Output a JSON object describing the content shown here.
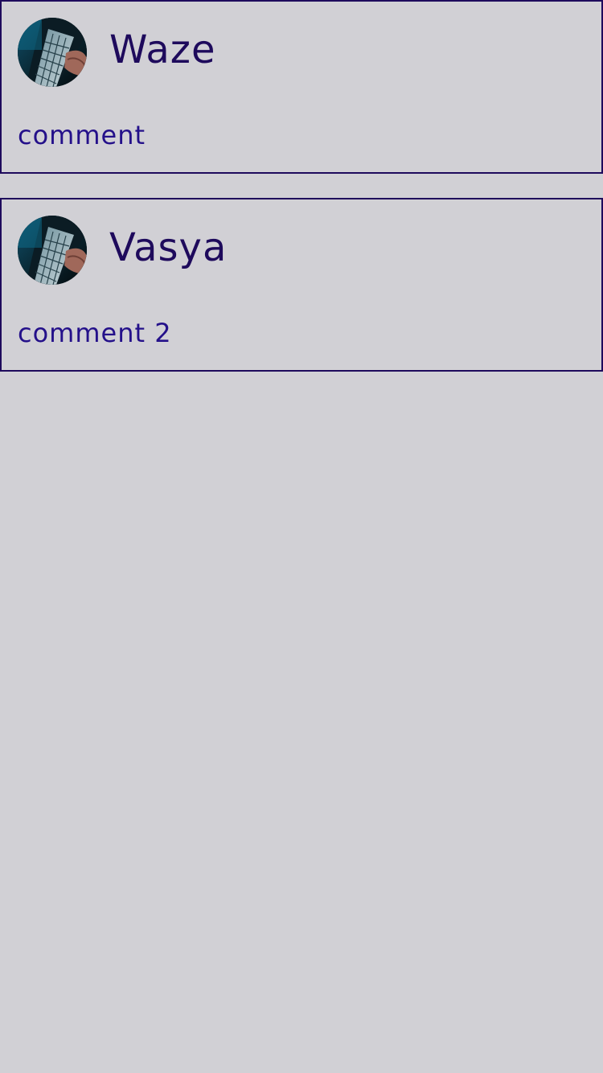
{
  "colors": {
    "background": "#d1d0d5",
    "border": "#1e0a5c",
    "author_text": "#1e0a5c",
    "comment_text": "#24108a"
  },
  "comments": [
    {
      "author": "Waze",
      "text": "comment",
      "avatar_icon": "laptop-keyboard-photo"
    },
    {
      "author": "Vasya",
      "text": "comment 2",
      "avatar_icon": "laptop-keyboard-photo"
    }
  ]
}
